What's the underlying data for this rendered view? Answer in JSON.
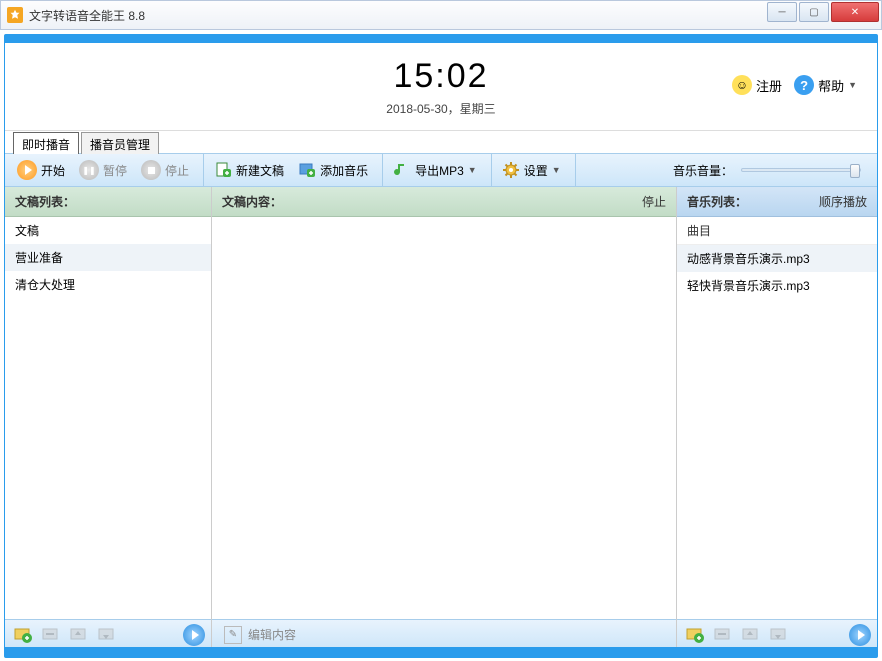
{
  "app": {
    "title": "文字转语音全能王 8.8"
  },
  "clock": {
    "time": "15:02",
    "date": "2018-05-30，星期三"
  },
  "headerButtons": {
    "register": "注册",
    "help": "帮助"
  },
  "tabs": {
    "active": "即时播音",
    "other": "播音员管理"
  },
  "toolbar": {
    "start": "开始",
    "pause": "暂停",
    "stop": "停止",
    "newDoc": "新建文稿",
    "addMusic": "添加音乐",
    "exportMp3": "导出MP3",
    "settings": "设置",
    "volumeLabel": "音乐音量："
  },
  "panels": {
    "left": {
      "title": "文稿列表：",
      "items": [
        "文稿",
        "营业准备",
        "清仓大处理"
      ]
    },
    "center": {
      "title": "文稿内容：",
      "action": "停止",
      "editPlaceholder": "编辑内容"
    },
    "right": {
      "title": "音乐列表：",
      "mode": "顺序播放",
      "colHeader": "曲目",
      "items": [
        "动感背景音乐演示.mp3",
        "轻快背景音乐演示.mp3"
      ]
    }
  }
}
